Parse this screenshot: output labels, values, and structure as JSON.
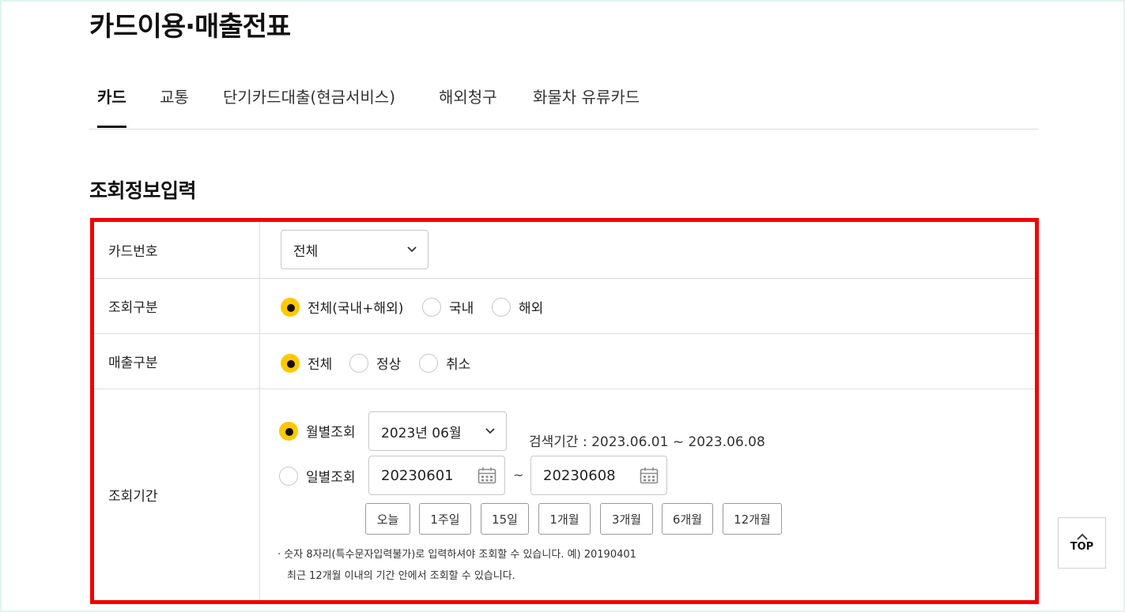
{
  "page_title": "카드이용·매출전표",
  "tabs": [
    {
      "label": "카드",
      "active": true
    },
    {
      "label": "교통",
      "active": false
    },
    {
      "label": "단기카드대출(현금서비스)",
      "active": false
    },
    {
      "label": "해외청구",
      "active": false
    },
    {
      "label": "화물차 유류카드",
      "active": false
    }
  ],
  "section_title": "조회정보입력",
  "form": {
    "card_number": {
      "label": "카드번호",
      "selected": "전체"
    },
    "inquiry_type": {
      "label": "조회구분",
      "options": [
        {
          "label": "전체(국내+해외)",
          "checked": true
        },
        {
          "label": "국내",
          "checked": false
        },
        {
          "label": "해외",
          "checked": false
        }
      ]
    },
    "sales_type": {
      "label": "매출구분",
      "options": [
        {
          "label": "전체",
          "checked": true
        },
        {
          "label": "정상",
          "checked": false
        },
        {
          "label": "취소",
          "checked": false
        }
      ]
    },
    "period": {
      "label": "조회기간",
      "monthly": {
        "label": "월별조회",
        "checked": true,
        "selected": "2023년 06월"
      },
      "search_range": "검색기간 : 2023.06.01 ~ 2023.06.08",
      "daily": {
        "label": "일별조회",
        "checked": false,
        "start": "20230601",
        "end": "20230608",
        "separator": "~"
      },
      "quick_buttons": [
        "오늘",
        "1주일",
        "15일",
        "1개월",
        "3개월",
        "6개월",
        "12개월"
      ],
      "notes": [
        "· 숫자 8자리(특수문자입력불가)로 입력하셔야 조회할 수 있습니다. 예) 20190401",
        "최근 12개월 이내의 기간 안에서 조회할 수 있습니다."
      ]
    }
  },
  "top_button": "TOP",
  "colors": {
    "accent": "#ffc800",
    "highlight_border": "#f20000"
  }
}
